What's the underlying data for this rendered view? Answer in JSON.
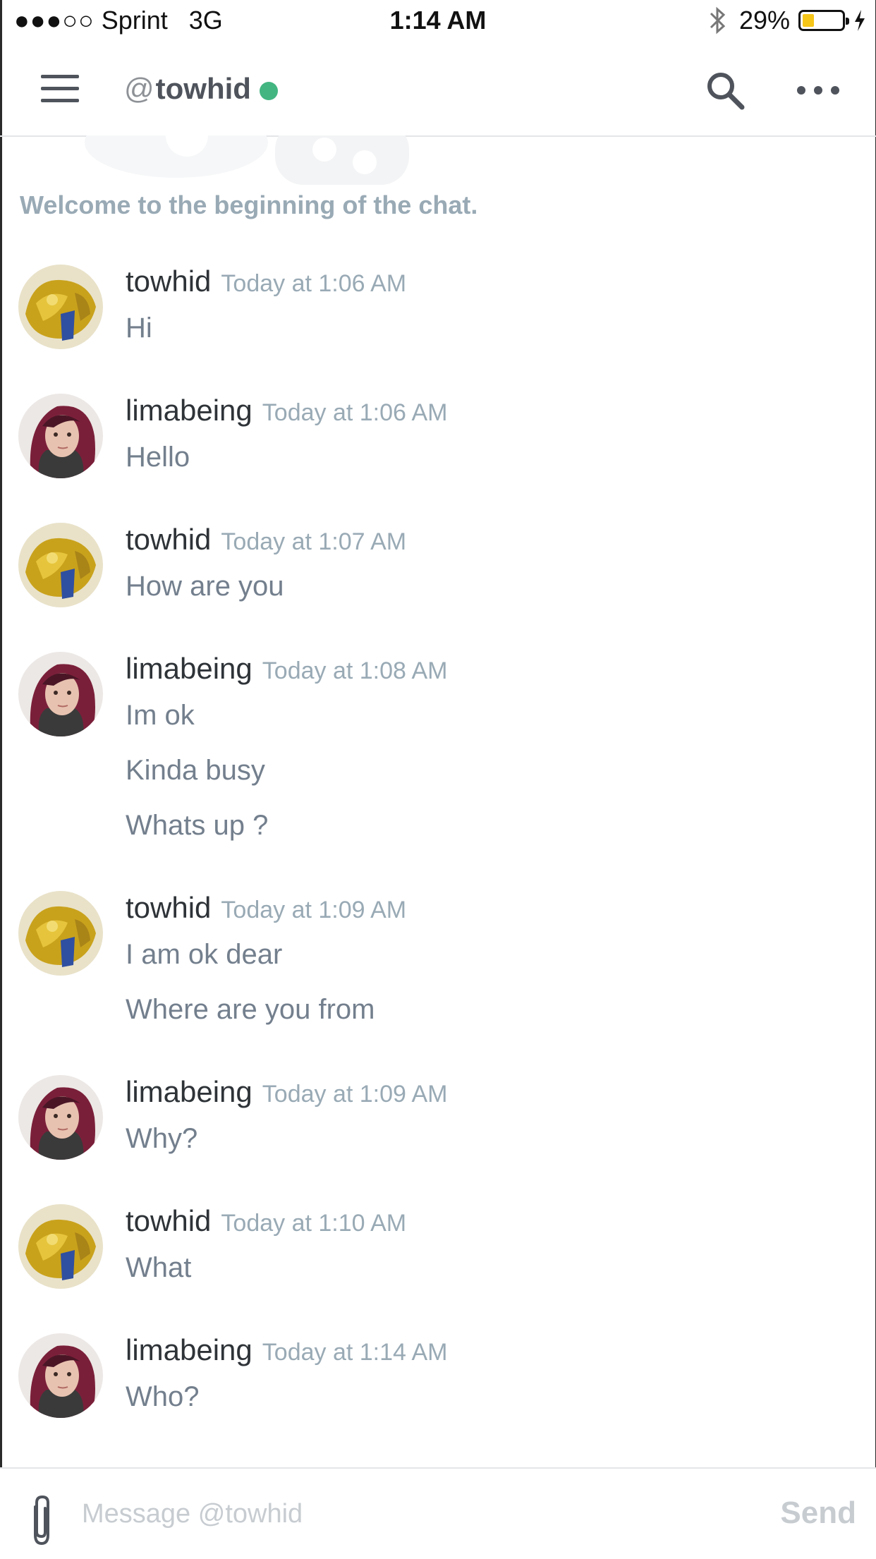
{
  "status_bar": {
    "signal": "●●●○○",
    "carrier": "Sprint",
    "network": "3G",
    "time": "1:14 AM",
    "battery": "29%",
    "battery_level": 0.29,
    "icons": [
      "bluetooth-icon",
      "battery-icon",
      "charging-bolt-icon"
    ]
  },
  "header": {
    "at": "@",
    "channel_name": "towhid",
    "status": "online",
    "status_color": "#43b581",
    "icons": [
      "hamburger-menu-icon",
      "search-icon",
      "more-options-icon"
    ]
  },
  "chat": {
    "welcome": "Welcome to the beginning of the chat.",
    "messages": [
      {
        "author": "towhid",
        "time": "Today at 1:06 AM",
        "lines": [
          "Hi"
        ]
      },
      {
        "author": "limabeing",
        "time": "Today at 1:06 AM",
        "lines": [
          "Hello"
        ]
      },
      {
        "author": "towhid",
        "time": "Today at 1:07 AM",
        "lines": [
          "How are you"
        ]
      },
      {
        "author": "limabeing",
        "time": "Today at 1:08 AM",
        "lines": [
          "Im ok",
          "Kinda busy",
          "Whats up ?"
        ]
      },
      {
        "author": "towhid",
        "time": "Today at 1:09 AM",
        "lines": [
          "I am ok dear",
          "Where are you from"
        ]
      },
      {
        "author": "limabeing",
        "time": "Today at 1:09 AM",
        "lines": [
          "Why?"
        ]
      },
      {
        "author": "towhid",
        "time": "Today at 1:10 AM",
        "lines": [
          "What"
        ]
      },
      {
        "author": "limabeing",
        "time": "Today at 1:14 AM",
        "lines": [
          "Who?"
        ]
      }
    ]
  },
  "composer": {
    "placeholder": "Message @towhid",
    "value": "",
    "send_label": "Send"
  }
}
